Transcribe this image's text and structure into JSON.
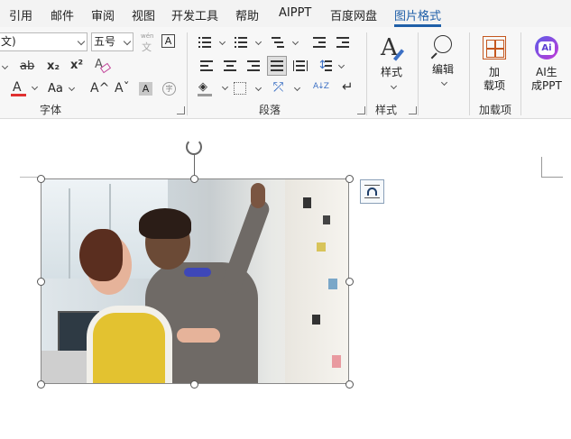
{
  "menu": {
    "tabs": [
      {
        "label": "引用"
      },
      {
        "label": "邮件"
      },
      {
        "label": "审阅"
      },
      {
        "label": "视图"
      },
      {
        "label": "开发工具"
      },
      {
        "label": "帮助"
      },
      {
        "label": "AIPPT"
      },
      {
        "label": "百度网盘"
      },
      {
        "label": "图片格式",
        "active": true
      }
    ]
  },
  "font_group": {
    "font_name": "文)",
    "font_size": "五号",
    "phonetic_top": "wén",
    "phonetic_char": "文",
    "char_border": "A",
    "strikethrough": "ab",
    "subscript": "x₂",
    "superscript": "x²",
    "font_color_letter": "A",
    "font_color": "#e03030",
    "change_case": "Aa",
    "grow_font": "A^",
    "shrink_font": "Aˇ",
    "char_shading": "A",
    "enclose_char": "字",
    "label": "字体"
  },
  "paragraph_group": {
    "label": "段落",
    "sort_icon": "A↓Z"
  },
  "styles_group": {
    "button_label": "样式",
    "label": "样式"
  },
  "editing_group": {
    "button_label": "编辑"
  },
  "addins_group": {
    "button_label": "加\n载项",
    "label": "加载项"
  },
  "ai_group": {
    "button_label": "AI生\n成PPT",
    "badge": "Ai"
  }
}
